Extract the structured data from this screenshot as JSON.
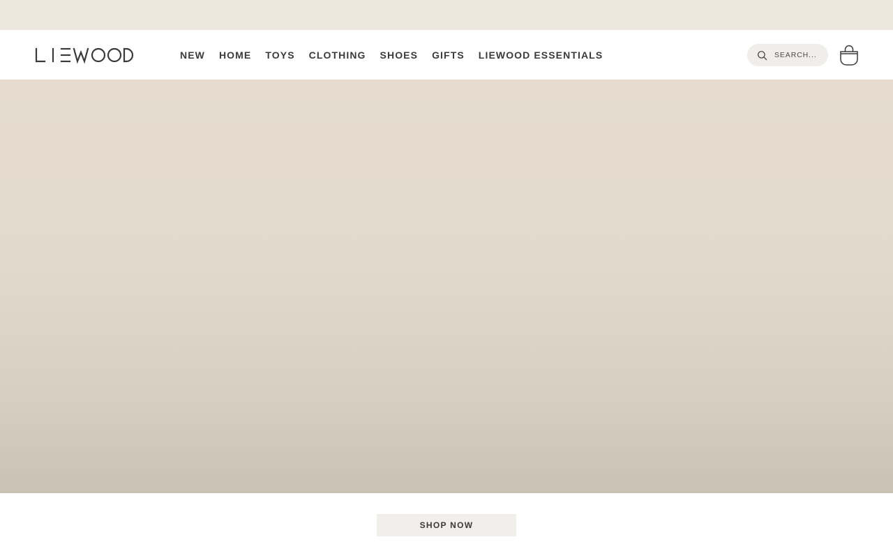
{
  "announcement_bar": {
    "text": ""
  },
  "header": {
    "logo_text": "LIEWOOD",
    "nav": [
      {
        "label": "NEW"
      },
      {
        "label": "HOME"
      },
      {
        "label": "TOYS"
      },
      {
        "label": "CLOTHING"
      },
      {
        "label": "SHOES"
      },
      {
        "label": "GIFTS"
      },
      {
        "label": "LIEWOOD ESSENTIALS"
      }
    ],
    "search": {
      "placeholder": "SEARCH...",
      "icon": "search-icon"
    },
    "cart": {
      "icon": "shopping-bag-icon"
    }
  },
  "hero": {
    "cta_label": "SHOP NOW"
  },
  "colors": {
    "announcement_bg": "#ede6dc",
    "hero_top": "#e5dccf",
    "hero_bottom": "#cac1b5",
    "text": "#3b3a38",
    "search_bg": "#f0eeeb",
    "cta_bg": "#f0efec"
  }
}
